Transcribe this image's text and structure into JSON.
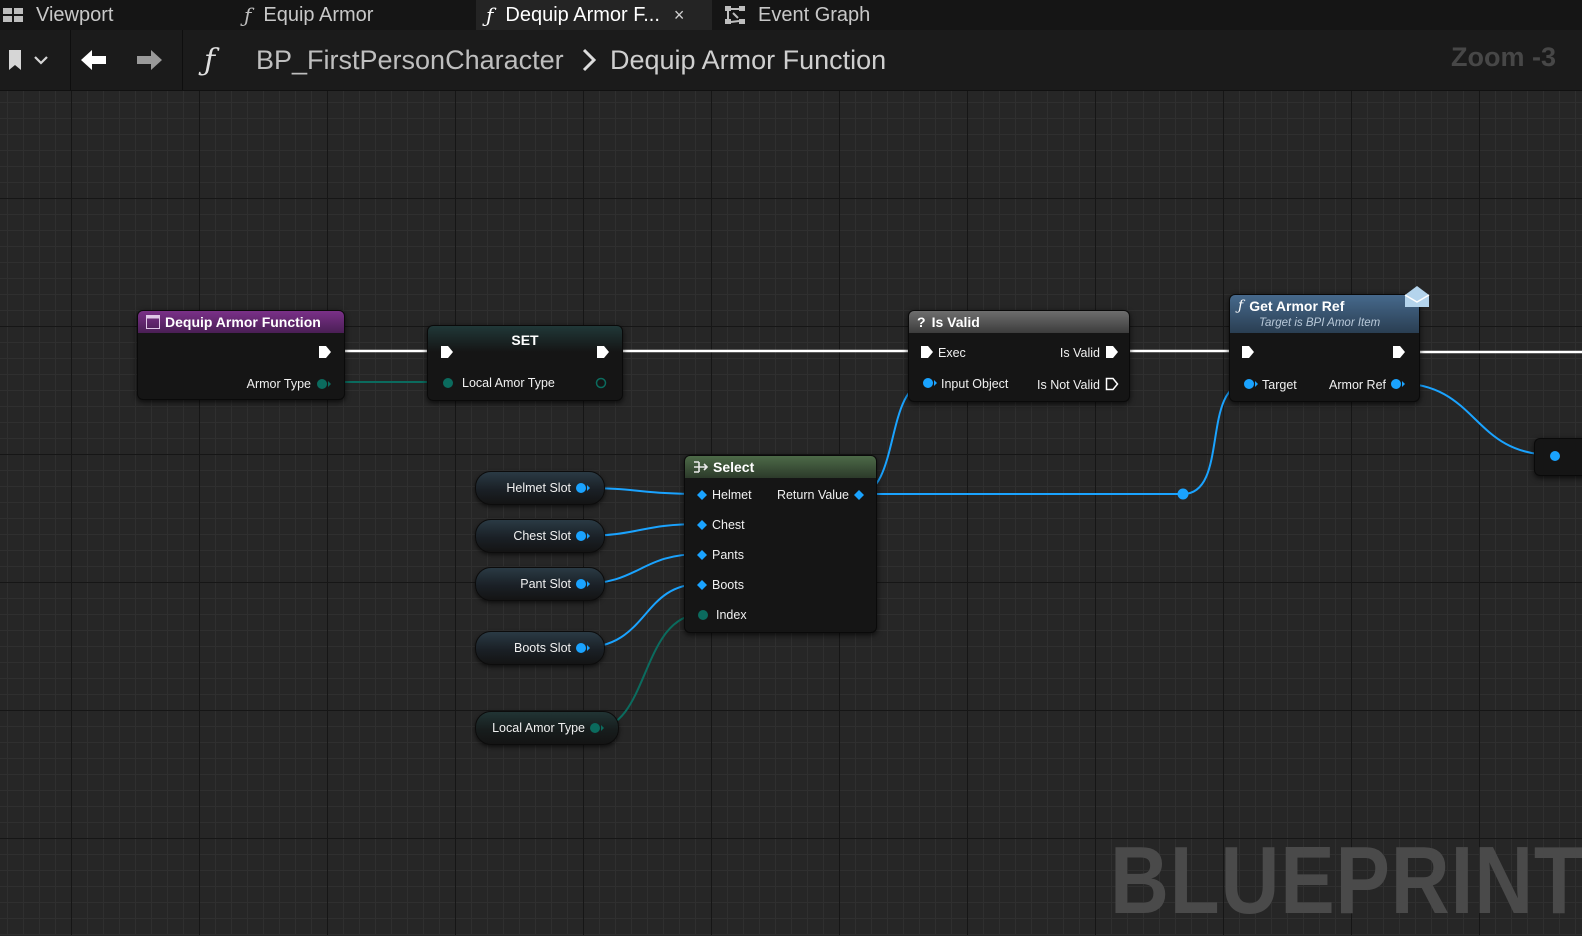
{
  "tabs": [
    {
      "label": "Viewport",
      "icon": "viewport-icon",
      "active": false
    },
    {
      "label": "Equip Armor",
      "icon": "function-icon",
      "active": false
    },
    {
      "label": "Dequip Armor F...",
      "icon": "function-icon",
      "active": true,
      "close": "×"
    },
    {
      "label": "Event Graph",
      "icon": "event-graph-icon",
      "active": false
    }
  ],
  "toolbar": {
    "function_glyph": "ƒ",
    "breadcrumb": [
      "BP_FirstPersonCharacter",
      "Dequip Armor Function"
    ],
    "zoom": "Zoom -3"
  },
  "nodes": {
    "entry": {
      "title": "Dequip Armor Function",
      "pins": [
        "Armor Type"
      ]
    },
    "set": {
      "title": "SET",
      "pins": [
        "Local Amor Type"
      ]
    },
    "is_valid": {
      "title": "Is Valid",
      "pins": [
        "Exec",
        "Input Object",
        "Is Valid",
        "Is Not Valid"
      ]
    },
    "get_armor_ref": {
      "title": "Get Armor Ref",
      "subtitle": "Target is BPI Amor Item",
      "pins": [
        "Target",
        "Armor Ref"
      ]
    },
    "select": {
      "title": "Select",
      "pins": [
        "Helmet",
        "Chest",
        "Pants",
        "Boots",
        "Index",
        "Return Value"
      ]
    }
  },
  "variables": [
    "Helmet Slot",
    "Chest Slot",
    "Pant Slot",
    "Boots Slot",
    "Local Amor Type"
  ],
  "watermark": "BLUEPRINT",
  "colors": {
    "exec_wire": "#ffffff",
    "object_pin": "#1aa3ff",
    "enum_pin": "#0b6b5e",
    "entry_header": "#6a2a7a",
    "select_header": "#3f5a3a",
    "function_header": "#3a5a78",
    "pure_header": "#5a5a5a"
  }
}
